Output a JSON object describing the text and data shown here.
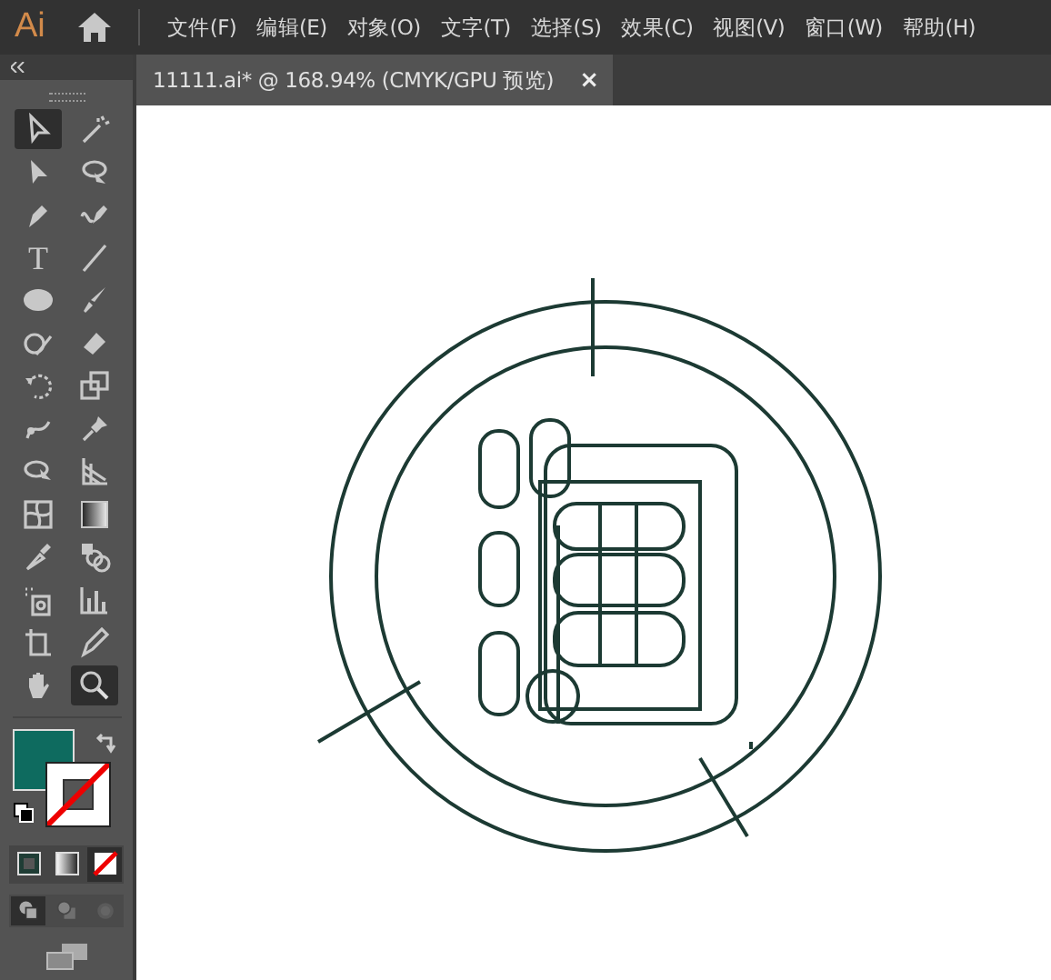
{
  "app": {
    "logo": "Ai"
  },
  "menu": [
    {
      "label": "文件(F)"
    },
    {
      "label": "编辑(E)"
    },
    {
      "label": "对象(O)"
    },
    {
      "label": "文字(T)"
    },
    {
      "label": "选择(S)"
    },
    {
      "label": "效果(C)"
    },
    {
      "label": "视图(V)"
    },
    {
      "label": "窗口(W)"
    },
    {
      "label": "帮助(H)"
    }
  ],
  "document_tab": {
    "title": "11111.ai* @ 168.94% (CMYK/GPU 预览)",
    "close": "×"
  },
  "tools": [
    {
      "kind": "selection",
      "selected": true
    },
    {
      "kind": "wand",
      "selected": false
    },
    {
      "kind": "direct",
      "selected": false
    },
    {
      "kind": "lasso",
      "selected": false
    },
    {
      "kind": "pen",
      "selected": false
    },
    {
      "kind": "curvature",
      "selected": false
    },
    {
      "kind": "type",
      "glyph": "T",
      "selected": false
    },
    {
      "kind": "line",
      "selected": false
    },
    {
      "kind": "ellipse",
      "selected": false
    },
    {
      "kind": "brush",
      "selected": false
    },
    {
      "kind": "shaper",
      "selected": false
    },
    {
      "kind": "eraser",
      "selected": false
    },
    {
      "kind": "rotate",
      "selected": false
    },
    {
      "kind": "scale",
      "selected": false
    },
    {
      "kind": "puppet",
      "selected": false
    },
    {
      "kind": "pin",
      "selected": false
    },
    {
      "kind": "shapebuilder",
      "selected": false
    },
    {
      "kind": "perspective",
      "selected": false
    },
    {
      "kind": "mesh",
      "selected": false
    },
    {
      "kind": "gradient",
      "selected": false
    },
    {
      "kind": "eyedropper",
      "selected": false
    },
    {
      "kind": "blend",
      "selected": false
    },
    {
      "kind": "sprayer",
      "selected": false
    },
    {
      "kind": "graph",
      "selected": false
    },
    {
      "kind": "artboard",
      "selected": false
    },
    {
      "kind": "pencil",
      "selected": false
    },
    {
      "kind": "hand",
      "selected": false
    },
    {
      "kind": "zoom",
      "selected": true
    }
  ],
  "swatches": [
    {
      "kind": "fill",
      "color": "#0e6b5f"
    },
    {
      "kind": "stroke_none"
    }
  ],
  "color_modes": [
    {
      "kind": "color",
      "selected": false
    },
    {
      "kind": "gradient",
      "selected": false
    },
    {
      "kind": "none",
      "selected": true
    }
  ],
  "draw_modes": [
    {
      "kind": "normal",
      "selected": true
    },
    {
      "kind": "behind",
      "selected": false
    },
    {
      "kind": "inside",
      "selected": false
    }
  ]
}
